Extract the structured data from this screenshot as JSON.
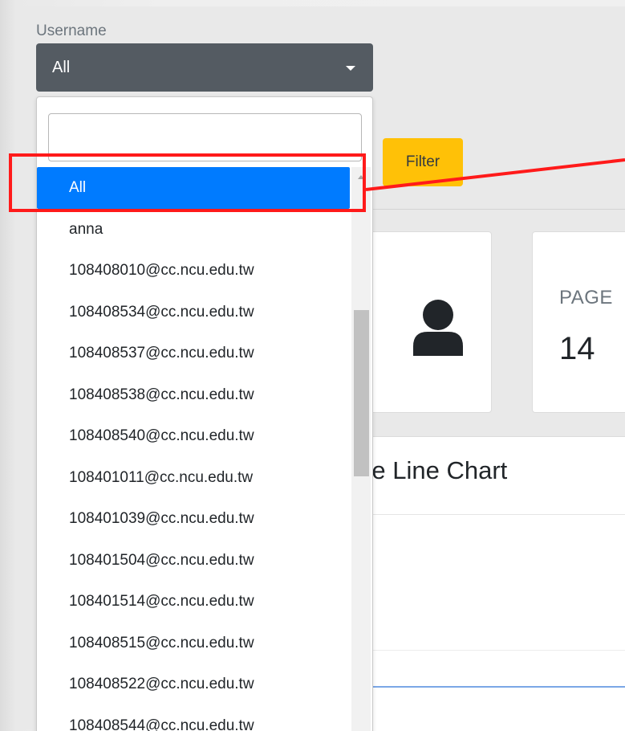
{
  "colors": {
    "select_bg": "#545b62",
    "filter_button_bg": "#ffc107",
    "selected_option_bg": "#007bff",
    "highlight": "#ff1a1a",
    "chart_line": "#7ba7e6"
  },
  "filter": {
    "username_label": "Username",
    "selected_value": "All",
    "search_value": "",
    "button_label": "Filter"
  },
  "dropdown": {
    "options": [
      {
        "label": "All",
        "selected": true
      },
      {
        "label": "anna"
      },
      {
        "label": "108408010@cc.ncu.edu.tw"
      },
      {
        "label": "108408534@cc.ncu.edu.tw"
      },
      {
        "label": "108408537@cc.ncu.edu.tw"
      },
      {
        "label": "108408538@cc.ncu.edu.tw"
      },
      {
        "label": "108408540@cc.ncu.edu.tw"
      },
      {
        "label": "108401011@cc.ncu.edu.tw"
      },
      {
        "label": "108401039@cc.ncu.edu.tw"
      },
      {
        "label": "108401504@cc.ncu.edu.tw"
      },
      {
        "label": "108401514@cc.ncu.edu.tw"
      },
      {
        "label": "108408515@cc.ncu.edu.tw"
      },
      {
        "label": "108408522@cc.ncu.edu.tw"
      },
      {
        "label": "108408544@cc.ncu.edu.tw"
      }
    ]
  },
  "cards": {
    "user_icon": "user-icon",
    "page_label": "PAGE",
    "page_value": "14"
  },
  "chart": {
    "title": "ive Line Chart"
  }
}
